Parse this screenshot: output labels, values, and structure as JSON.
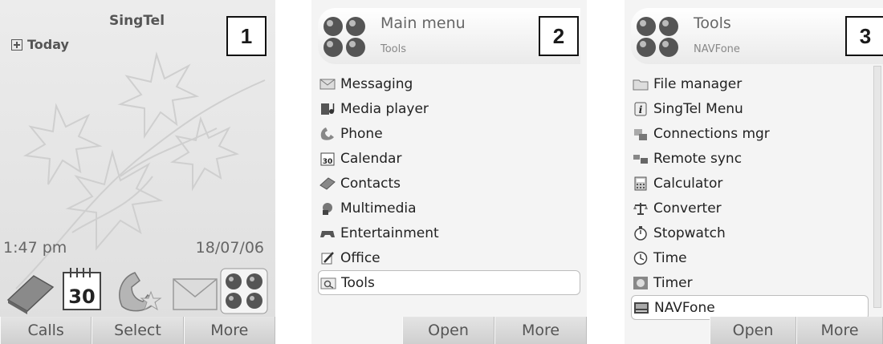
{
  "screen1": {
    "number": "1",
    "carrier": "SingTel",
    "today": "Today",
    "time": "1:47 pm",
    "date": "18/07/06",
    "calendar_icon_text": "30",
    "softkeys": [
      "Calls",
      "Select",
      "More"
    ],
    "dock_icons": [
      "contacts-book-icon",
      "calendar-icon",
      "phone-icon",
      "envelope-icon",
      "main-menu-icon"
    ]
  },
  "screen2": {
    "number": "2",
    "title": "Main menu",
    "subtitle": "Tools",
    "items": [
      {
        "label": "Messaging",
        "icon": "envelope-icon"
      },
      {
        "label": "Media player",
        "icon": "media-player-icon"
      },
      {
        "label": "Phone",
        "icon": "phone-icon"
      },
      {
        "label": "Calendar",
        "icon": "calendar-icon"
      },
      {
        "label": "Contacts",
        "icon": "contacts-book-icon"
      },
      {
        "label": "Multimedia",
        "icon": "multimedia-icon"
      },
      {
        "label": "Entertainment",
        "icon": "gamepad-icon"
      },
      {
        "label": "Office",
        "icon": "office-icon"
      },
      {
        "label": "Tools",
        "icon": "tools-icon",
        "selected": true
      }
    ],
    "softkeys": [
      "",
      "Open",
      "More"
    ]
  },
  "screen3": {
    "number": "3",
    "title": "Tools",
    "subtitle": "NAVFone",
    "items": [
      {
        "label": "File manager",
        "icon": "folder-icon"
      },
      {
        "label": "SingTel Menu",
        "icon": "info-icon"
      },
      {
        "label": "Connections mgr",
        "icon": "connections-icon"
      },
      {
        "label": "Remote sync",
        "icon": "sync-icon"
      },
      {
        "label": "Calculator",
        "icon": "calculator-icon"
      },
      {
        "label": "Converter",
        "icon": "scale-icon"
      },
      {
        "label": "Stopwatch",
        "icon": "stopwatch-icon"
      },
      {
        "label": "Time",
        "icon": "clock-icon"
      },
      {
        "label": "Timer",
        "icon": "timer-icon"
      },
      {
        "label": "NAVFone",
        "icon": "navfone-icon",
        "selected": true
      }
    ],
    "softkeys": [
      "",
      "Open",
      "More"
    ]
  },
  "colors": {
    "screen_bg": "#f2f2f2",
    "softkey_bg": "#d6d6d6",
    "text": "#1a1a1a",
    "muted_text": "#666666",
    "selection_bg": "#ffffff"
  }
}
